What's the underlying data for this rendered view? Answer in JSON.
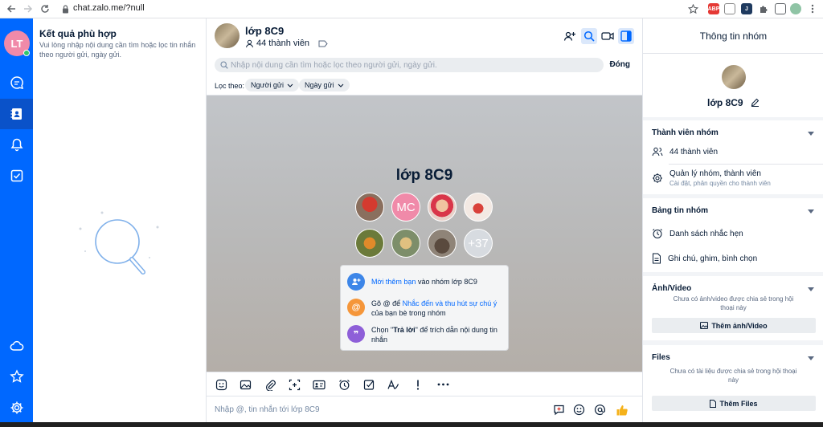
{
  "browser": {
    "url": "chat.zalo.me/?null"
  },
  "user": {
    "initials": "LT"
  },
  "results": {
    "title": "Kết quả phù hợp",
    "description": "Vui lòng nhập nội dung cần tìm hoặc lọc tin nhắn theo người gửi, ngày gửi."
  },
  "chat": {
    "group_name": "lớp 8C9",
    "member_count": "44 thành viên",
    "search_placeholder": "Nhập nội dung cần tìm hoặc lọc theo người gửi, ngày gửi.",
    "close_label": "Đóng",
    "filter_label": "Lọc theo:",
    "filter_sender": "Người gửi",
    "filter_date": "Ngày gửi",
    "big_name": "lớp 8C9",
    "avatar_mc": "MC",
    "more_members": "+37",
    "tips": {
      "t1_link": "Mời thêm bạn",
      "t1_rest": " vào nhóm lớp 8C9",
      "t2_pre": "Gõ @ để ",
      "t2_link": "Nhắc đến và thu hút sự chú ý",
      "t2_rest": " của bạn bè trong nhóm",
      "t3_pre": "Chọn \"",
      "t3_bold": "Trả lời",
      "t3_rest": "\" để trích dẫn nội dung tin nhắn"
    },
    "composer_placeholder": "Nhập @, tin nhắn tới lớp 8C9"
  },
  "info": {
    "title": "Thông tin nhóm",
    "group_name": "lớp 8C9",
    "members_section": "Thành viên nhóm",
    "members_count": "44 thành viên",
    "manage": "Quản lý nhóm, thành viên",
    "manage_sub": "Cài đặt, phân quyền cho thành viên",
    "board_section": "Bảng tin nhóm",
    "reminders": "Danh sách nhắc hẹn",
    "notes": "Ghi chú, ghim, bình chọn",
    "media_section": "Ảnh/Video",
    "media_note": "Chưa có ảnh/video được chia sẻ trong hội thoại này",
    "media_button": "Thêm ảnh/Video",
    "files_section": "Files",
    "files_note": "Chưa có tài liệu được chia sẻ trong hội thoại này",
    "files_button": "Thêm Files"
  },
  "colors": {
    "primary": "#0068ff",
    "nav_active": "#0a52c9",
    "avatar": "#f08aa9",
    "online": "#30c76d"
  }
}
